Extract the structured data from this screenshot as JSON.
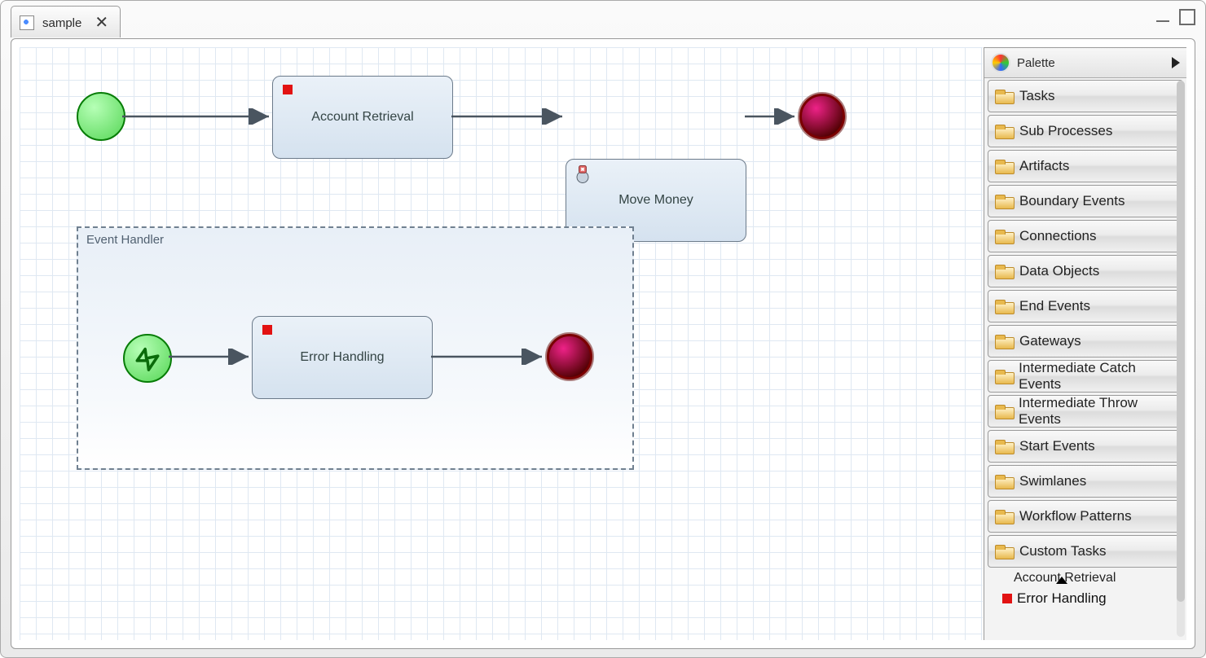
{
  "tab": {
    "label": "sample"
  },
  "diagram": {
    "task_account": "Account Retrieval",
    "task_move": "Move Money",
    "subproc_label": "Event Handler",
    "task_error": "Error Handling"
  },
  "palette": {
    "title": "Palette",
    "drawers": [
      "Tasks",
      "Sub Processes",
      "Artifacts",
      "Boundary Events",
      "Connections",
      "Data Objects",
      "End Events",
      "Gateways",
      "Intermediate Catch Events",
      "Intermediate Throw Events",
      "Start Events",
      "Swimlanes",
      "Workflow Patterns",
      "Custom Tasks"
    ],
    "custom_item_1": "Account Retrieval",
    "custom_item_2": "Error Handling"
  }
}
